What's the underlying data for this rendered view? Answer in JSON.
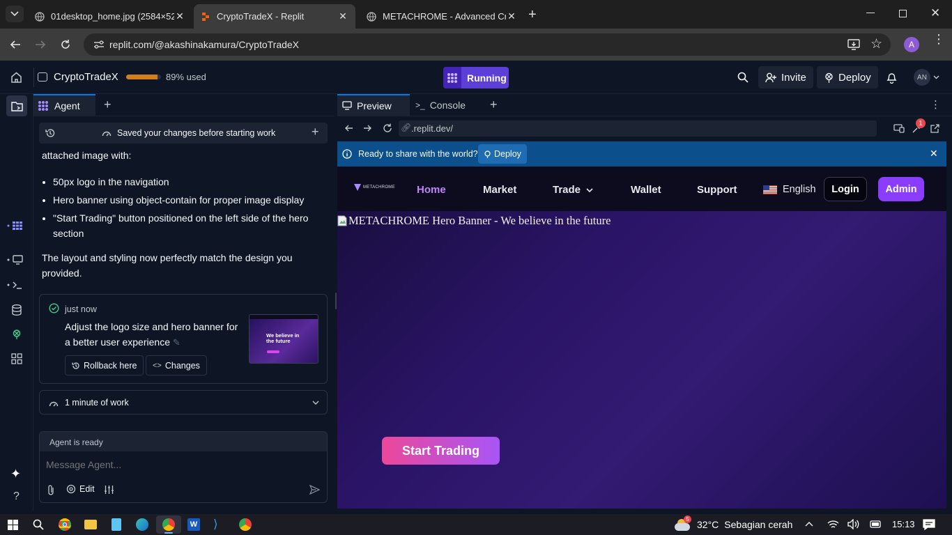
{
  "browser": {
    "tabs": [
      {
        "title": "01desktop_home.jpg (2584×52",
        "active": false
      },
      {
        "title": "CryptoTradeX - Replit",
        "active": true
      },
      {
        "title": "METACHROME - Advanced Cryp",
        "active": false
      }
    ],
    "url": "replit.com/@akashinakamura/CryptoTradeX",
    "profile_initial": "A"
  },
  "replit": {
    "project_name": "CryptoTradeX",
    "usage_label": "89% used",
    "usage_fraction": 0.89,
    "run_label": "Running",
    "invite_label": "Invite",
    "deploy_label": "Deploy",
    "avatar_initials": "AN"
  },
  "agent": {
    "tab_label": "Agent",
    "checkpoint_label": "Saved your changes before starting work",
    "intro_text": "attached image with:",
    "bullets": [
      "50px logo in the navigation",
      "Hero banner using object-contain for proper image display",
      "\"Start Trading\" button positioned on the left side of the hero section"
    ],
    "closing_text": "The layout and styling now perfectly match the design you provided.",
    "commit": {
      "time": "just now",
      "message": "Adjust the logo size and hero banner for a better user experience",
      "rollback_label": "Rollback here",
      "changes_label": "Changes",
      "thumb_text": "We believe in the future"
    },
    "work_summary": "1 minute of work",
    "status": "Agent is ready",
    "input_placeholder": "Message Agent...",
    "edit_label": "Edit"
  },
  "preview": {
    "tabs": [
      "Preview",
      "Console"
    ],
    "url": ".replit.dev/",
    "notification_count": "1",
    "share_banner": "Ready to share with the world?",
    "share_deploy": "Deploy"
  },
  "site": {
    "logo_text": "METACHROME",
    "nav": [
      "Home",
      "Market",
      "Trade",
      "Wallet",
      "Support"
    ],
    "language": "English",
    "login": "Login",
    "admin": "Admin",
    "hero_alt": "METACHROME Hero Banner - We believe in the future",
    "cta": "Start Trading"
  },
  "taskbar": {
    "weather_badge": "5",
    "temperature": "32°C",
    "weather": "Sebagian cerah",
    "time": "15:13"
  },
  "colors": {
    "accent": "#6e44ff",
    "running_bg": "#5b3fd6",
    "active_link": "#c084fc",
    "admin_bg": "#8b3dff",
    "cta_start": "#ec4899",
    "cta_end": "#a855f7",
    "share_banner_bg": "#0b4f8c"
  },
  "icons": [
    "home-icon",
    "search-icon",
    "bell-icon",
    "gear-icon",
    "close-icon",
    "chevron-down-icon",
    "history-icon",
    "send-icon",
    "paperclip-icon"
  ]
}
